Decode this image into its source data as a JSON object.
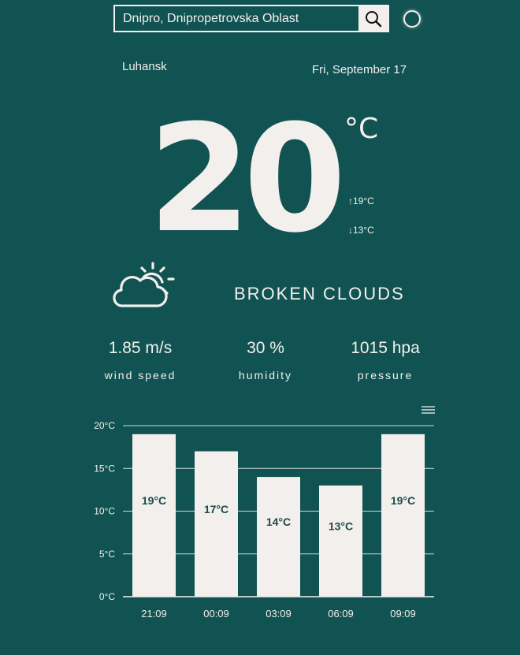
{
  "search": {
    "value": "Dnipro, Dnipropetrovska Oblast",
    "placeholder": "",
    "icon": "search-icon"
  },
  "header": {
    "city": "Luhansk",
    "date": "Fri, September 17"
  },
  "current": {
    "temperature": "20",
    "unit": "°C",
    "max": "↑19°C",
    "min": "↓13°C",
    "icon": "cloud-sun-icon",
    "description": "BROKEN CLOUDS"
  },
  "metrics": {
    "wind": {
      "value": "1.85 m/s",
      "label": "wind speed"
    },
    "humidity": {
      "value": "30 %",
      "label": "humidity"
    },
    "pressure": {
      "value": "1015 hpa",
      "label": "pressure"
    }
  },
  "colors": {
    "background": "#115352",
    "foreground": "#f2efec",
    "bar_label": "#1b4b4a"
  },
  "chart_data": {
    "type": "bar",
    "categories": [
      "21:09",
      "00:09",
      "03:09",
      "06:09",
      "09:09"
    ],
    "values": [
      19,
      17,
      14,
      13,
      19
    ],
    "data_labels": [
      "19°C",
      "17°C",
      "14°C",
      "13°C",
      "19°C"
    ],
    "y_ticks": [
      0,
      5,
      10,
      15,
      20
    ],
    "y_tick_labels": [
      "0°C",
      "5°C",
      "10°C",
      "15°C",
      "20°C"
    ],
    "ylim": [
      0,
      20
    ],
    "grid": true,
    "title": "",
    "xlabel": "",
    "ylabel": ""
  }
}
